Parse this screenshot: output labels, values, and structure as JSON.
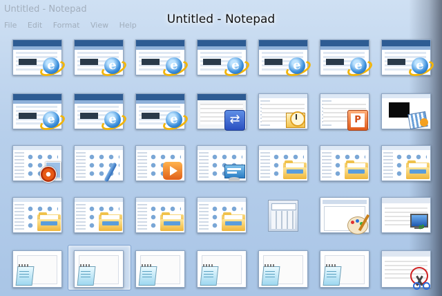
{
  "window": {
    "title": "Untitled - Notepad",
    "faded_title": "Untitled - Notepad",
    "menu": [
      "File",
      "Edit",
      "Format",
      "View",
      "Help"
    ]
  },
  "colors": {
    "background": "#b7cfeb",
    "ie_blue": "#2e5c93",
    "folder": "#f0b73b"
  },
  "switcher": {
    "selected_index": 29,
    "rows": [
      [
        "ie",
        "ie",
        "ie",
        "ie",
        "ie",
        "ie",
        "ie"
      ],
      [
        "ie",
        "ie",
        "ie",
        "sync",
        "outlook",
        "powerpoint",
        "movie-maker"
      ],
      [
        "photo-gallery",
        "pen-input",
        "media-center",
        "gadgets",
        "explorer",
        "explorer",
        "explorer"
      ],
      [
        "explorer",
        "explorer",
        "explorer",
        "explorer",
        "calculator",
        "paint",
        "remote-desktop"
      ],
      [
        "notepad",
        "notepad",
        "notepad",
        "notepad",
        "notepad",
        "notepad",
        "snipping-tool"
      ]
    ]
  }
}
